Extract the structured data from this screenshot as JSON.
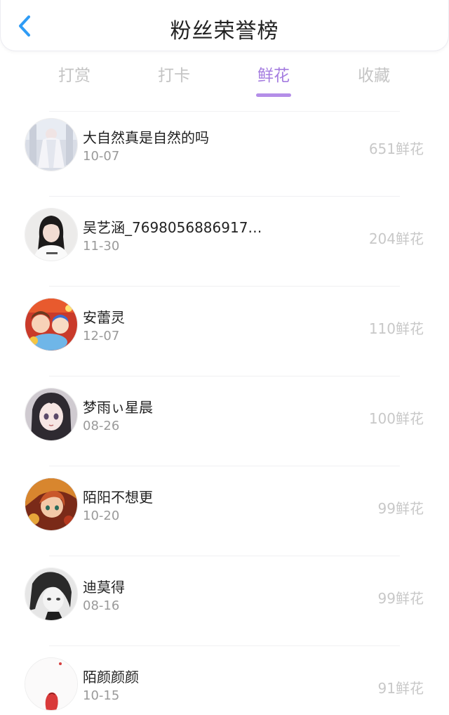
{
  "header": {
    "back_icon": "chevron-left-icon",
    "title": "粉丝荣誉榜",
    "accent_color": "#2f9cf5"
  },
  "tabs": [
    {
      "label": "打赏",
      "active": false
    },
    {
      "label": "打卡",
      "active": false
    },
    {
      "label": "鲜花",
      "active": true
    },
    {
      "label": "收藏",
      "active": false
    }
  ],
  "active_tab_color": "#a57de0",
  "fans": [
    {
      "name": "大自然真是自然的吗",
      "date": "10-07",
      "count": "651鲜花",
      "avatar": "avatar-white-dress"
    },
    {
      "name": "吴艺涵_7698056886917…",
      "date": "11-30",
      "count": "204鲜花",
      "avatar": "avatar-girl-photo"
    },
    {
      "name": "安蕾灵",
      "date": "12-07",
      "count": "110鲜花",
      "avatar": "avatar-anime-colorful"
    },
    {
      "name": "梦雨ぃ星晨",
      "date": "08-26",
      "count": "100鲜花",
      "avatar": "avatar-anime-dark-hair"
    },
    {
      "name": "陌阳不想更",
      "date": "10-20",
      "count": "99鲜花",
      "avatar": "avatar-anime-warm"
    },
    {
      "name": "迪莫得",
      "date": "08-16",
      "count": "99鲜花",
      "avatar": "avatar-anime-monochrome"
    },
    {
      "name": "陌颜颜颜",
      "date": "10-15",
      "count": "91鲜花",
      "avatar": "avatar-white-red"
    }
  ]
}
